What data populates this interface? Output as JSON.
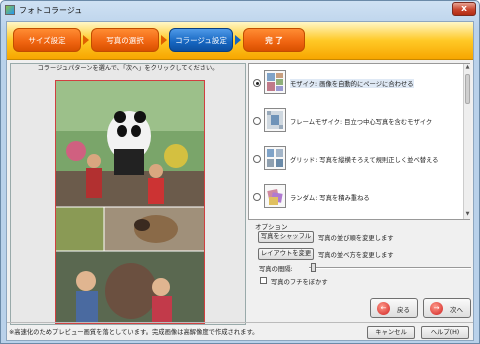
{
  "window": {
    "title": "フォトコラージュ",
    "close_glyph": "x"
  },
  "steps": [
    {
      "label": "サイズ設定",
      "state": "done"
    },
    {
      "label": "写真の選択",
      "state": "done"
    },
    {
      "label": "コラージュ設定",
      "state": "active"
    },
    {
      "label": "完 了",
      "state": "pending"
    }
  ],
  "preview": {
    "hint": "コラージュパターンを選んで、「次へ」をクリックしてください。"
  },
  "patterns": [
    {
      "label": "モザイク: 画像を自動的にページに合わせる",
      "selected": true,
      "icon": "mosaic-icon"
    },
    {
      "label": "フレームモザイク: 目立つ中心写真を含むモザイク",
      "selected": false,
      "icon": "frame-mosaic-icon"
    },
    {
      "label": "グリッド: 写真を縦横そろえて規則正しく並べ替える",
      "selected": false,
      "icon": "grid-icon"
    },
    {
      "label": "ランダム: 写真を積み重ねる",
      "selected": false,
      "icon": "random-stack-icon"
    }
  ],
  "options": {
    "title": "オプション",
    "shuffle_button": "写真をシャッフル",
    "shuffle_desc": "写真の並び順を変更します",
    "layout_button": "レイアウトを変更",
    "layout_desc": "写真の並べ方を変更します",
    "spacing_label": "写真の間隔:",
    "spacing_value": 0.02,
    "blur_label": "写真のフチをぼかす",
    "blur_checked": false
  },
  "nav": {
    "back": "戻る",
    "next": "次へ"
  },
  "footer": {
    "note": "※高速化のためプレビュー画質を落としています。完成画像は高解像度で作成されます。",
    "cancel": "キャンセル",
    "help": "ヘルプ(H)"
  },
  "colors": {
    "step_orange": "#ef6410",
    "step_active": "#1565c0",
    "banner_yellow": "#ffc926"
  }
}
